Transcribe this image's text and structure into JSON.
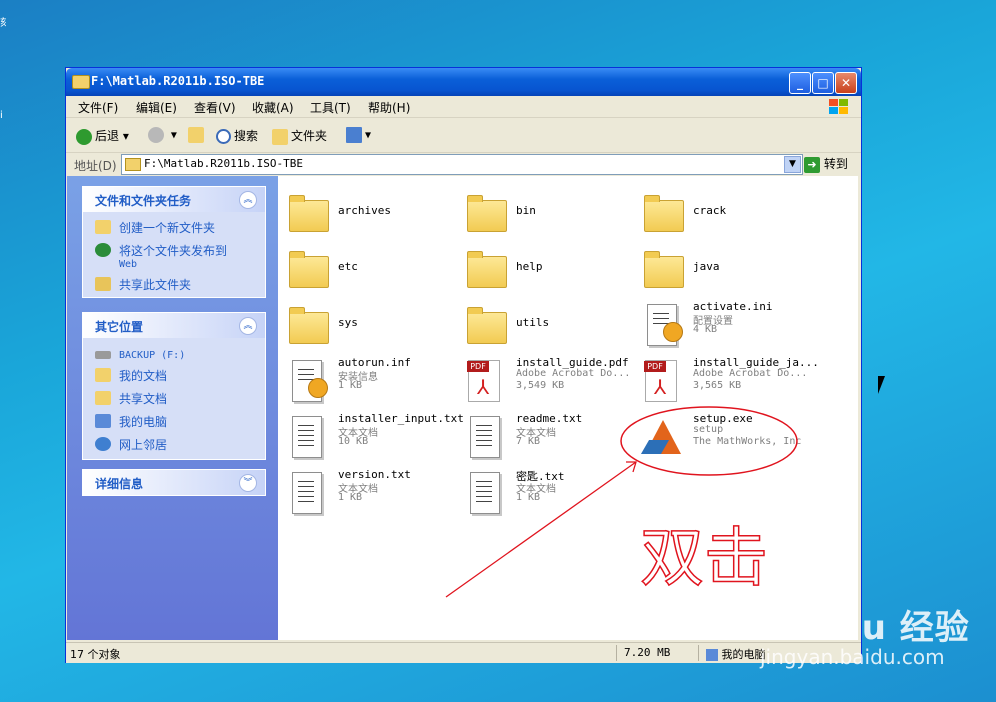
{
  "window": {
    "title": "F:\\Matlab.R2011b.ISO-TBE",
    "buttons": {
      "minimize": "_",
      "maximize": "□",
      "close": "✕"
    }
  },
  "menu": [
    "文件(F)",
    "编辑(E)",
    "查看(V)",
    "收藏(A)",
    "工具(T)",
    "帮助(H)"
  ],
  "toolbar": {
    "back": "后退",
    "search": "搜索",
    "folders": "文件夹"
  },
  "address": {
    "label": "地址(D)",
    "value": "F:\\Matlab.R2011b.ISO-TBE",
    "go": "转到"
  },
  "panels": {
    "tasks": {
      "title": "文件和文件夹任务",
      "links": [
        "创建一个新文件夹",
        "将这个文件夹发布到",
        "共享此文件夹"
      ],
      "link2_sub": "Web"
    },
    "places": {
      "title": "其它位置",
      "links": [
        "BACKUP (F:)",
        "我的文档",
        "共享文档",
        "我的电脑",
        "网上邻居"
      ]
    },
    "details": {
      "title": "详细信息"
    }
  },
  "files": [
    {
      "name": "archives",
      "kind": "folder"
    },
    {
      "name": "bin",
      "kind": "folder"
    },
    {
      "name": "crack",
      "kind": "folder"
    },
    {
      "name": "etc",
      "kind": "folder"
    },
    {
      "name": "help",
      "kind": "folder"
    },
    {
      "name": "java",
      "kind": "folder"
    },
    {
      "name": "sys",
      "kind": "folder"
    },
    {
      "name": "utils",
      "kind": "folder"
    },
    {
      "name": "activate.ini",
      "type": "配置设置",
      "size": "4 KB",
      "kind": "ini"
    },
    {
      "name": "autorun.inf",
      "type": "安装信息",
      "size": "1 KB",
      "kind": "ini"
    },
    {
      "name": "install_guide.pdf",
      "type": "Adobe Acrobat Do...",
      "size": "3,549 KB",
      "kind": "pdf"
    },
    {
      "name": "install_guide_ja...",
      "type": "Adobe Acrobat Do...",
      "size": "3,565 KB",
      "kind": "pdf"
    },
    {
      "name": "installer_input.txt",
      "type": "文本文档",
      "size": "10 KB",
      "kind": "txt"
    },
    {
      "name": "readme.txt",
      "type": "文本文档",
      "size": "7 KB",
      "kind": "txt"
    },
    {
      "name": "setup.exe",
      "type": "setup",
      "size": "The MathWorks, Inc",
      "kind": "exe"
    },
    {
      "name": "version.txt",
      "type": "文本文档",
      "size": "1 KB",
      "kind": "txt"
    },
    {
      "name": "密匙.txt",
      "type": "文本文档",
      "size": "1 KB",
      "kind": "txt"
    }
  ],
  "status": {
    "count": "17 个对象",
    "size": "7.20 MB",
    "location": "我的电脑"
  },
  "annotation": {
    "handwriting": "双击",
    "color": "#e0141e"
  },
  "watermark": {
    "logo": "Bai du 经验",
    "site": "jingyan.baidu.com"
  }
}
